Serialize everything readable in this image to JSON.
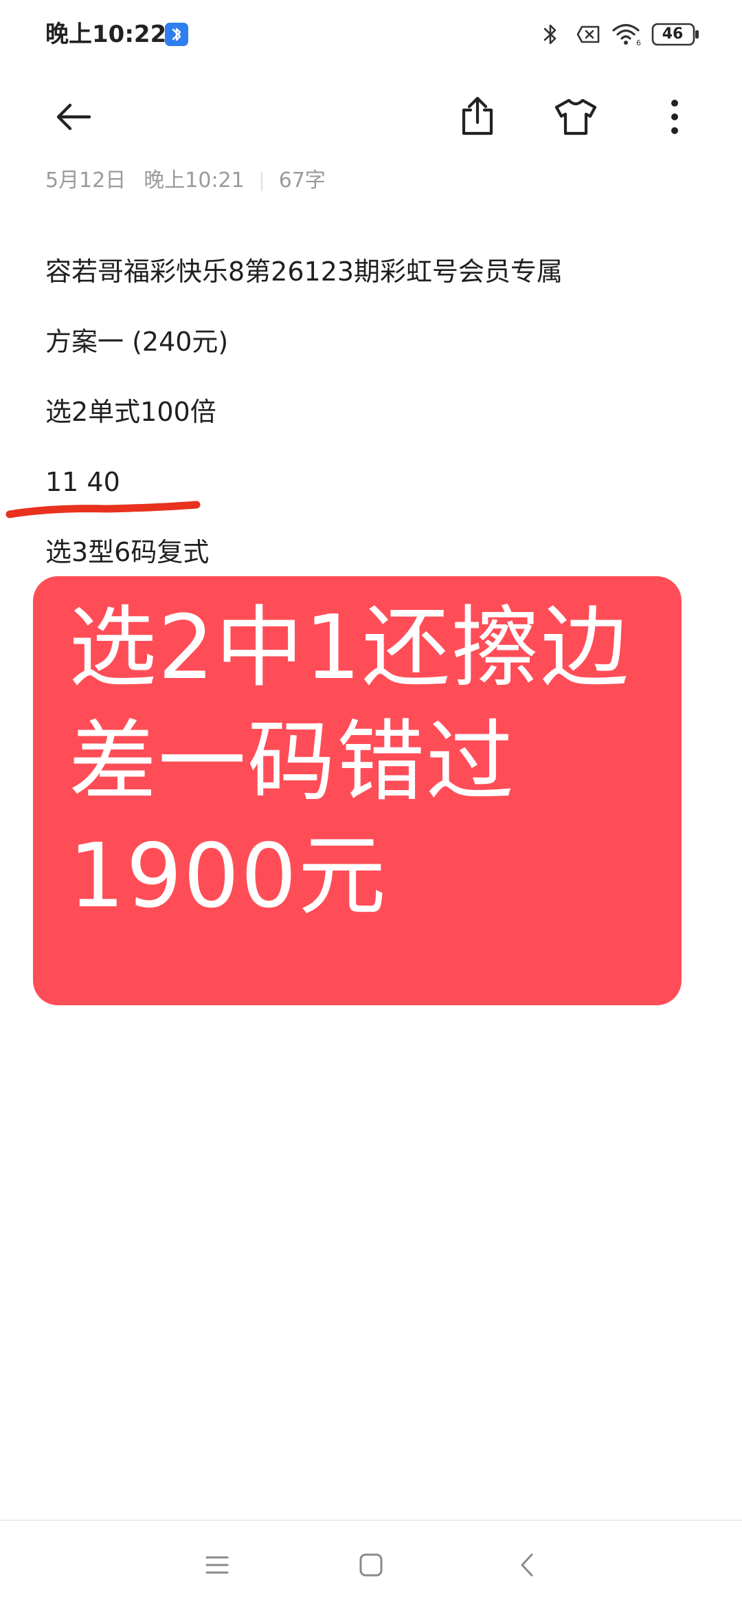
{
  "status_bar": {
    "time": "晚上10:22",
    "battery_level": "46",
    "icons": [
      "bluetooth-badge-icon",
      "bluetooth-icon",
      "sim-no-service-icon",
      "wifi-icon",
      "battery-icon"
    ]
  },
  "toolbar": {
    "icons": [
      "back-arrow-icon",
      "share-icon",
      "theme-shirt-icon",
      "more-vertical-icon"
    ]
  },
  "meta": {
    "date": "5月12日",
    "time": "晚上10:21",
    "word_count": "67字"
  },
  "note": {
    "lines": [
      "容若哥福彩快乐8第26123期彩虹号会员专属",
      "方案一 (240元)",
      "选2单式100倍",
      "11 40",
      "选3型6码复式"
    ]
  },
  "overlay": {
    "lines": [
      "选2中1还擦边",
      "差一码错过",
      "1900元"
    ],
    "background": "#ff4d57",
    "text_color": "#ffffff"
  },
  "nav_bar": {
    "icons": [
      "menu-icon",
      "home-square-icon",
      "back-chevron-icon"
    ]
  },
  "colors": {
    "underline": "#e8321e",
    "meta_text": "#9a9a9a",
    "bluetooth_badge": "#2e7ef0"
  }
}
